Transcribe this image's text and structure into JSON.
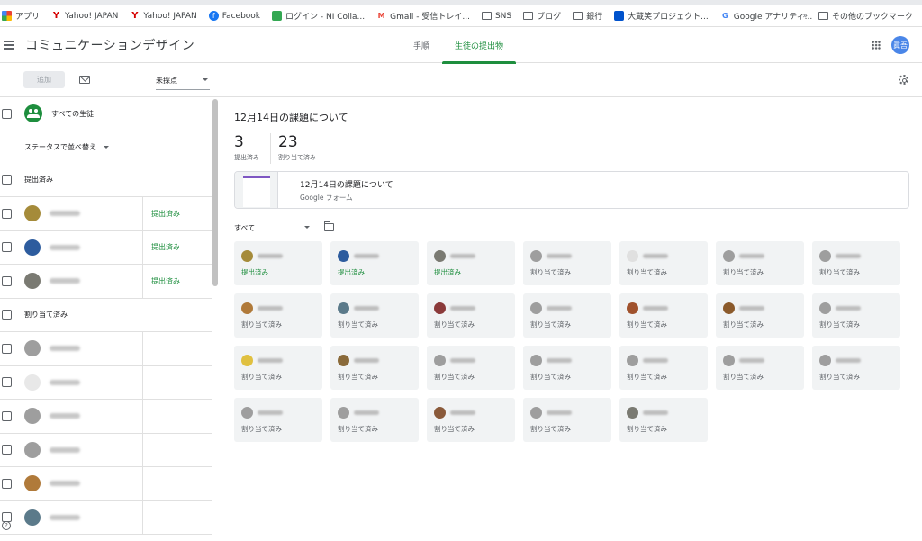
{
  "bookmarks": {
    "items": [
      {
        "label": "アプリ",
        "icon": "apps-icon"
      },
      {
        "label": "Yahoo! JAPAN",
        "icon": "yahoo-icon"
      },
      {
        "label": "Yahoo! JAPAN",
        "icon": "yahoo-icon"
      },
      {
        "label": "Facebook",
        "icon": "facebook-icon"
      },
      {
        "label": "ログイン - NI Colla...",
        "icon": "ni-icon"
      },
      {
        "label": "Gmail - 受信トレイ...",
        "icon": "gmail-icon"
      },
      {
        "label": "SNS",
        "icon": "folder-icon"
      },
      {
        "label": "ブログ",
        "icon": "folder-icon"
      },
      {
        "label": "銀行",
        "icon": "folder-icon"
      },
      {
        "label": "大蔵笑プロジェクト...",
        "icon": "trello-icon"
      },
      {
        "label": "Google アナリティ...",
        "icon": "google-icon"
      }
    ],
    "more": "»",
    "other": "その他のブックマーク"
  },
  "app": {
    "title": "コミュニケーションデザイン",
    "tabs": [
      {
        "label": "手順",
        "active": false
      },
      {
        "label": "生徒の提出物",
        "active": true
      }
    ],
    "user_initials": "眞吾"
  },
  "toolbar": {
    "add_label": "追加",
    "sort_value": "未採点"
  },
  "left": {
    "all_students": "すべての生徒",
    "status_sort": "ステータスで並べ替え",
    "section_submitted": "提出済み",
    "section_assigned": "割り当て済み",
    "submitted_students": [
      {
        "status": "提出済み",
        "color": "#a58b3a"
      },
      {
        "status": "提出済み",
        "color": "#2d5c9e"
      },
      {
        "status": "提出済み",
        "color": "#7a7a72"
      }
    ],
    "assigned_students": [
      {
        "color": "#9e9e9e"
      },
      {
        "color": "#e8e8e8"
      },
      {
        "color": "#9e9e9e"
      },
      {
        "color": "#9e9e9e"
      },
      {
        "color": "#b07a3a"
      },
      {
        "color": "#5b7a8a"
      }
    ],
    "help": "?"
  },
  "assignment": {
    "title": "12月14日の課題について",
    "submitted_count": "3",
    "submitted_label": "提出済み",
    "assigned_count": "23",
    "assigned_label": "割り当て済み",
    "attachment_title": "12月14日の課題について",
    "attachment_type": "Google フォーム",
    "filter_value": "すべて"
  },
  "cards": [
    {
      "status": "提出済み",
      "done": true,
      "color": "#a58b3a"
    },
    {
      "status": "提出済み",
      "done": true,
      "color": "#2d5c9e"
    },
    {
      "status": "提出済み",
      "done": true,
      "color": "#7a7a72"
    },
    {
      "status": "割り当て済み",
      "done": false,
      "color": "#9e9e9e"
    },
    {
      "status": "割り当て済み",
      "done": false,
      "color": "#e0e0e0"
    },
    {
      "status": "割り当て済み",
      "done": false,
      "color": "#9e9e9e"
    },
    {
      "status": "割り当て済み",
      "done": false,
      "color": "#9e9e9e"
    },
    {
      "status": "割り当て済み",
      "done": false,
      "color": "#b07a3a"
    },
    {
      "status": "割り当て済み",
      "done": false,
      "color": "#5b7a8a"
    },
    {
      "status": "割り当て済み",
      "done": false,
      "color": "#8b3a3a"
    },
    {
      "status": "割り当て済み",
      "done": false,
      "color": "#9e9e9e"
    },
    {
      "status": "割り当て済み",
      "done": false,
      "color": "#a0522d"
    },
    {
      "status": "割り当て済み",
      "done": false,
      "color": "#8b5a2b"
    },
    {
      "status": "割り当て済み",
      "done": false,
      "color": "#9e9e9e"
    },
    {
      "status": "割り当て済み",
      "done": false,
      "color": "#e0c040"
    },
    {
      "status": "割り当て済み",
      "done": false,
      "color": "#8a6a3a"
    },
    {
      "status": "割り当て済み",
      "done": false,
      "color": "#9e9e9e"
    },
    {
      "status": "割り当て済み",
      "done": false,
      "color": "#9e9e9e"
    },
    {
      "status": "割り当て済み",
      "done": false,
      "color": "#9e9e9e"
    },
    {
      "status": "割り当て済み",
      "done": false,
      "color": "#9e9e9e"
    },
    {
      "status": "割り当て済み",
      "done": false,
      "color": "#9e9e9e"
    },
    {
      "status": "割り当て済み",
      "done": false,
      "color": "#9e9e9e"
    },
    {
      "status": "割り当て済み",
      "done": false,
      "color": "#9e9e9e"
    },
    {
      "status": "割り当て済み",
      "done": false,
      "color": "#8a5a3a"
    },
    {
      "status": "割り当て済み",
      "done": false,
      "color": "#9e9e9e"
    },
    {
      "status": "割り当て済み",
      "done": false,
      "color": "#7a7a72"
    }
  ],
  "colors": {
    "accent": "#1e8e3e",
    "user_avatar": "#4a86e8"
  }
}
